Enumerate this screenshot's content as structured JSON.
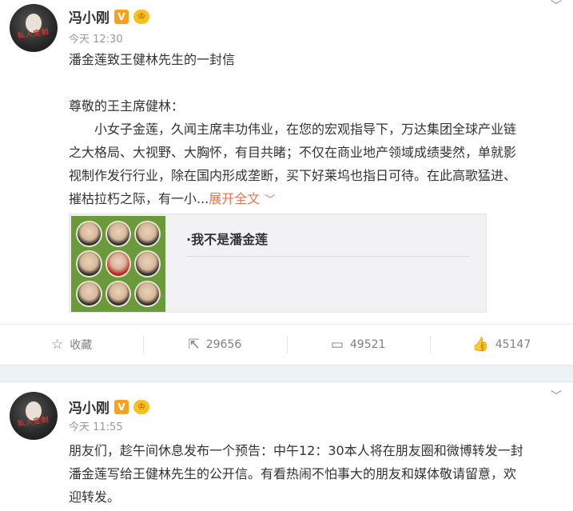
{
  "posts": [
    {
      "author": "冯小刚",
      "avatar_text": "私人定制",
      "time": "今天 12:30",
      "title": "潘金莲致王健林先生的一封信",
      "salutation": "尊敬的王主席健林：",
      "lines": [
        "小女子金莲，久闻主席丰功伟业，在您的宏观指导下，万达集团全球产业链",
        "之大格局、大视野、大胸怀，有目共睹；不仅在商业地产领域成绩斐然，单就影",
        "视制作发行行业，除在国内形成垄断，买下好莱坞也指日可待。在此高歌猛进、",
        "摧枯拉朽之际，有一小..."
      ],
      "expand_label": "展开全文",
      "card": {
        "title": "·我不是潘金莲"
      },
      "actions": {
        "favorite": "收藏",
        "repost": "29656",
        "comment": "49521",
        "like": "45147"
      }
    },
    {
      "author": "冯小刚",
      "avatar_text": "私人定制",
      "time": "今天 11:55",
      "lines": [
        "朋友们，趁午间休息发布一个预告：中午12：30本人将在朋友圈和微博转发一封",
        "潘金莲写给王健林先生的公开信。有看热闹不怕事大的朋友和媒体敬请留意，欢",
        "迎转发。"
      ]
    }
  ],
  "icons": {
    "verified": "V",
    "vip": "♔",
    "chevron": "﹀",
    "star": "☆",
    "repost": "⇱",
    "comment": "▭",
    "like": "👍"
  },
  "colors": {
    "accent": "#eb7350",
    "verified_badge": "#f7a21b",
    "separator": "#eef2f5"
  }
}
